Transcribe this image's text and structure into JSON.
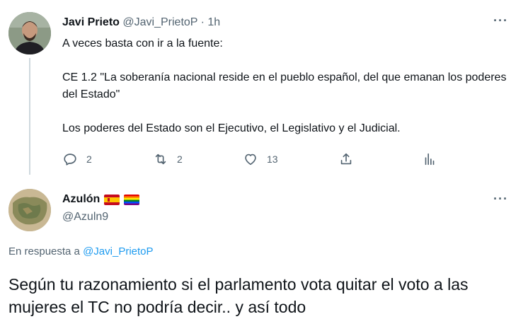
{
  "tweet1": {
    "author_name": "Javi Prieto",
    "author_handle": "@Javi_PrietoP",
    "separator": "·",
    "time": "1h",
    "more_label": "···",
    "paragraphs": [
      "A veces basta con ir a la fuente:",
      "CE 1.2 \"La soberanía nacional reside en el pueblo español, del que emanan los poderes del Estado\"",
      "Los poderes del Estado son el Ejecutivo, el Legislativo y el Judicial."
    ],
    "actions": {
      "replies": "2",
      "retweets": "2",
      "likes": "13"
    }
  },
  "tweet2": {
    "author_name": "Azulón",
    "author_handle": "@Azuln9",
    "more_label": "···",
    "reply_prefix": "En respuesta a",
    "reply_handle": "@Javi_PrietoP",
    "text": "Según tu razonamiento si el parlamento vota quitar el voto a las mujeres el TC no podría decir.. y así todo",
    "flags": [
      "spain-flag-icon",
      "rainbow-flag-icon"
    ]
  },
  "colors": {
    "text_primary": "#0f1419",
    "text_secondary": "#536471",
    "link": "#1d9bf0",
    "thread_line": "#cfd9de"
  }
}
